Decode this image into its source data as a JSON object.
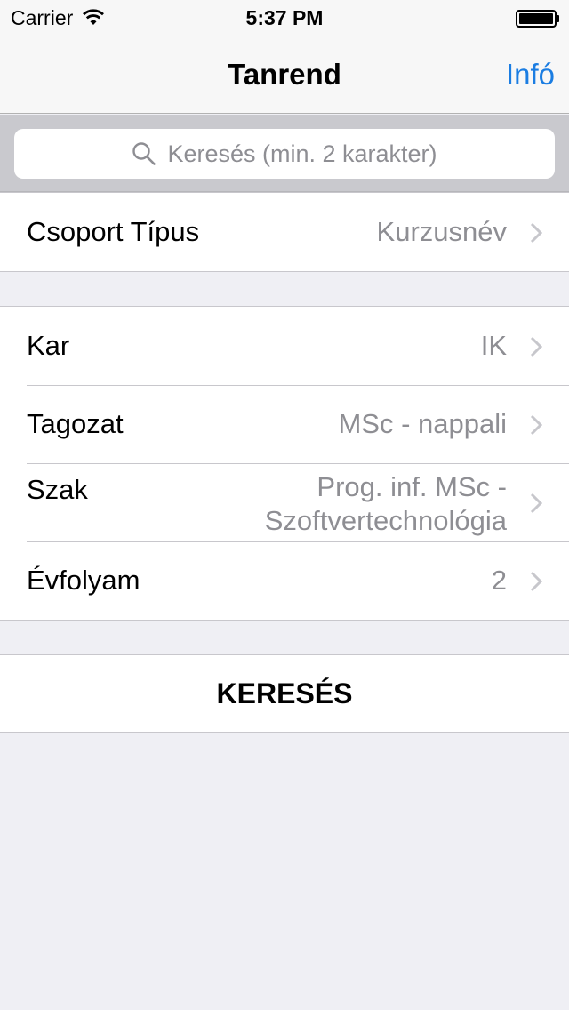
{
  "status": {
    "carrier": "Carrier",
    "time": "5:37 PM"
  },
  "nav": {
    "title": "Tanrend",
    "info_label": "Infó"
  },
  "search": {
    "placeholder": "Keresés (min. 2 karakter)"
  },
  "group_type": {
    "label": "Csoport Típus",
    "value": "Kurzusnév"
  },
  "filters": [
    {
      "label": "Kar",
      "value": "IK"
    },
    {
      "label": "Tagozat",
      "value": "MSc - nappali"
    },
    {
      "label": "Szak",
      "value": "Prog. inf. MSc - Szoftvertechnológia"
    },
    {
      "label": "Évfolyam",
      "value": "2"
    }
  ],
  "actions": {
    "search_label": "KERESÉS"
  },
  "colors": {
    "accent": "#1b7de2",
    "background": "#efeff4",
    "secondary_text": "#8e8e93"
  }
}
